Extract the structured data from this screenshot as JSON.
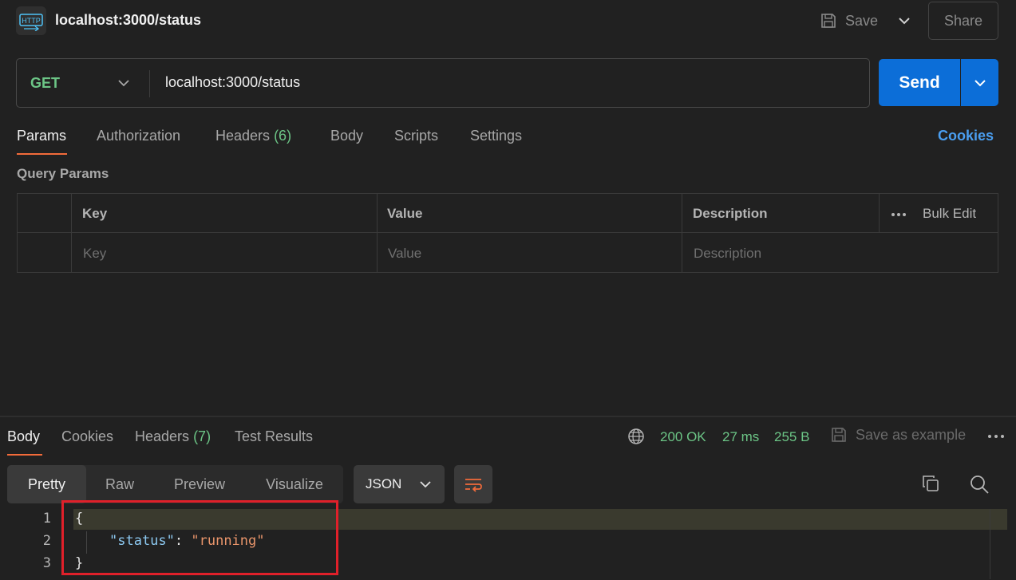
{
  "titlebar": {
    "icon_label": "HTTP",
    "title": "localhost:3000/status",
    "save_label": "Save",
    "share_label": "Share"
  },
  "request": {
    "method": "GET",
    "url": "localhost:3000/status",
    "send_label": "Send"
  },
  "request_tabs": {
    "params": "Params",
    "authorization": "Authorization",
    "headers": "Headers",
    "headers_count": "(6)",
    "body": "Body",
    "scripts": "Scripts",
    "settings": "Settings",
    "cookies": "Cookies"
  },
  "query_params": {
    "label": "Query Params",
    "columns": [
      "Key",
      "Value",
      "Description"
    ],
    "bulk_edit": "Bulk Edit",
    "placeholders": [
      "Key",
      "Value",
      "Description"
    ]
  },
  "response_tabs": {
    "body": "Body",
    "cookies": "Cookies",
    "headers": "Headers",
    "headers_count": "(7)",
    "test_results": "Test Results"
  },
  "response_meta": {
    "status": "200 OK",
    "time": "27 ms",
    "size": "255 B",
    "save_example": "Save as example"
  },
  "view_modes": [
    "Pretty",
    "Raw",
    "Preview",
    "Visualize"
  ],
  "format": "JSON",
  "code": {
    "line_numbers": [
      "1",
      "2",
      "3"
    ],
    "open_brace": "{",
    "key": "\"status\"",
    "colon": ": ",
    "value": "\"running\"",
    "close_brace": "}"
  },
  "colors": {
    "accent": "#f26b3a",
    "send": "#0c6ed8",
    "success": "#6cc586",
    "link": "#4a9ef0",
    "annotation": "#e0202a"
  }
}
